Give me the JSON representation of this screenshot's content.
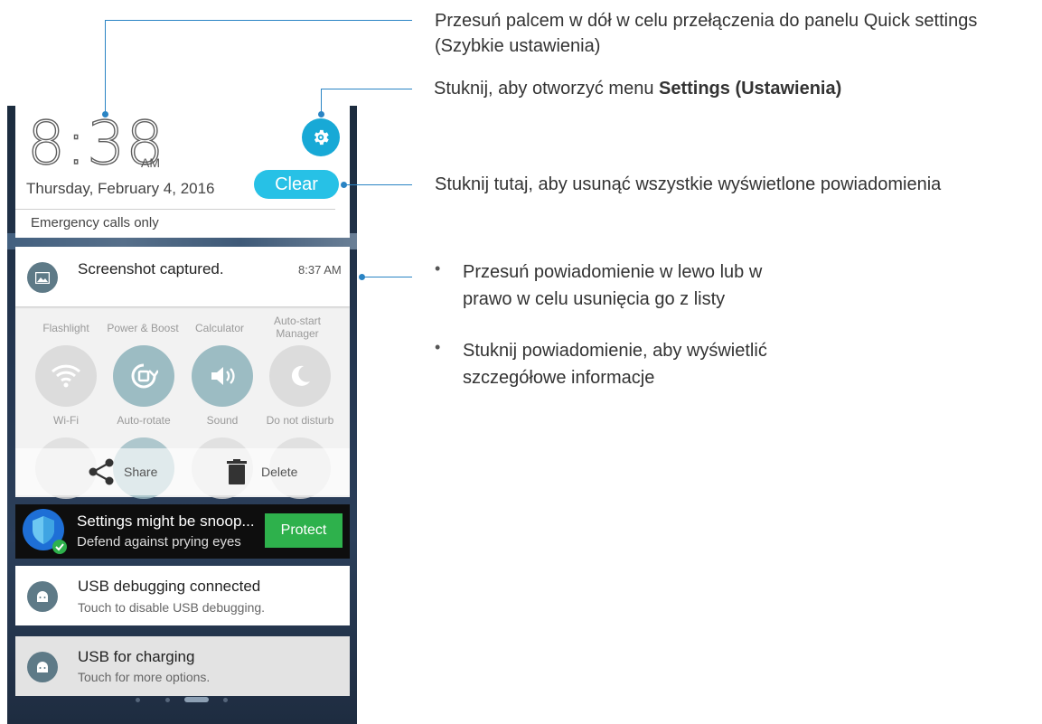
{
  "phone": {
    "time": "8:38",
    "ampm": "AM",
    "date": "Thursday, February 4, 2016",
    "clear_label": "Clear",
    "emergency": "Emergency calls only",
    "screenshot_notification": {
      "title": "Screenshot captured.",
      "time": "8:37 AM"
    },
    "quick_settings": {
      "row1_labels": [
        "Flashlight",
        "Power & Boost",
        "Calculator",
        "Auto-start Manager"
      ],
      "row2": [
        {
          "label": "Wi-Fi",
          "icon": "wifi-icon",
          "active": false
        },
        {
          "label": "Auto-rotate",
          "icon": "auto-rotate-icon",
          "active": true
        },
        {
          "label": "Sound",
          "icon": "sound-icon",
          "active": true
        },
        {
          "label": "Do not disturb",
          "icon": "moon-icon",
          "active": false
        }
      ]
    },
    "actions": {
      "share": "Share",
      "delete": "Delete"
    },
    "ad": {
      "title": "Settings might be snoop...",
      "subtitle": "Defend against prying eyes",
      "button": "Protect"
    },
    "usb_debugging": {
      "title": "USB debugging connected",
      "subtitle": "Touch to disable USB debugging."
    },
    "usb_charging": {
      "title": "USB for charging",
      "subtitle": "Touch for more options."
    }
  },
  "callouts": {
    "quick_settings_line1": "Przesuń palcem w dół w celu przełączenia do panelu Quick settings",
    "quick_settings_line2": "(Szybkie ustawienia)",
    "settings_prefix": "Stuknij, aby otworzyć menu ",
    "settings_bold": "Settings (Ustawienia)",
    "clear": "Stuknij tutaj, aby usunąć wszystkie wyświetlone powiadomienia",
    "bullet1_line1": "Przesuń powiadomienie w lewo lub w",
    "bullet1_line2": "prawo w celu usunięcia go z listy",
    "bullet2_line1": "Stuknij powiadomienie, aby wyświetlić",
    "bullet2_line2": "szczegółowe informacje"
  },
  "colors": {
    "accent": "#18a9d6",
    "clear": "#27c1e6",
    "protect": "#2eb14c",
    "callout_line": "#2a84c4"
  }
}
